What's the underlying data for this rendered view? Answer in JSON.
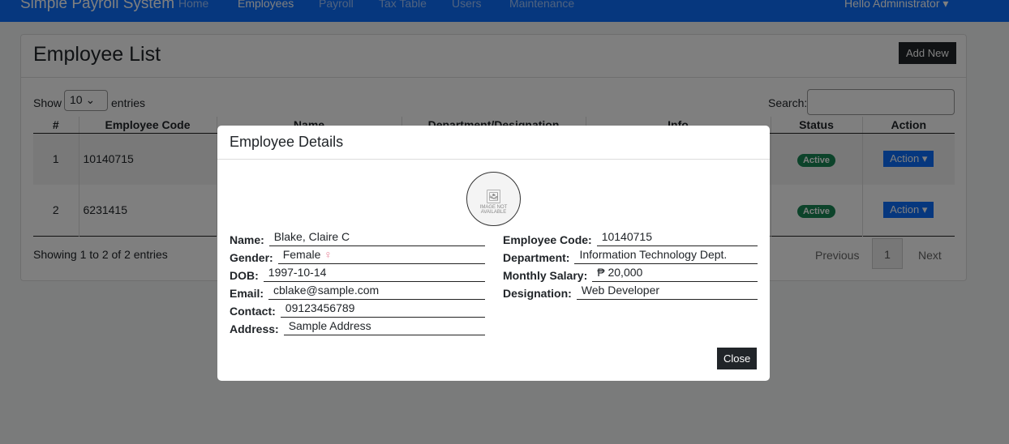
{
  "nav": {
    "brand": "Simple Payroll System",
    "items": [
      "Home",
      "Employees",
      "Payroll",
      "Tax Table",
      "Users",
      "Maintenance"
    ],
    "user": "Hello Administrator"
  },
  "card": {
    "title": "Employee List",
    "add_new": "Add New",
    "show": "Show",
    "entries_value": "10",
    "entries": "entries",
    "search": "Search:",
    "columns": [
      "#",
      "Employee Code",
      "Name",
      "Department/Designation",
      "Info",
      "Status",
      "Action"
    ],
    "rows": [
      {
        "n": "1",
        "code": "10140715",
        "status": "Active",
        "action": "Action"
      },
      {
        "n": "2",
        "code": "6231415",
        "status": "Active",
        "action": "Action"
      }
    ],
    "showing": "Showing 1 to 2 of 2 entries",
    "prev": "Previous",
    "page": "1",
    "next": "Next"
  },
  "modal": {
    "title": "Employee Details",
    "avatar_text": "IMAGE NOT AVAILABLE",
    "left": [
      {
        "label": "Name:",
        "value": "Blake, Claire C"
      },
      {
        "label": "Gender:",
        "value": "Female"
      },
      {
        "label": "DOB:",
        "value": "1997-10-14"
      },
      {
        "label": "Email:",
        "value": "cblake@sample.com"
      },
      {
        "label": "Contact:",
        "value": "09123456789"
      },
      {
        "label": "Address:",
        "value": "Sample Address"
      }
    ],
    "right": [
      {
        "label": "Employee Code:",
        "value": "10140715"
      },
      {
        "label": "Department:",
        "value": "Information Technology Dept."
      },
      {
        "label": "Monthly Salary:",
        "value": "₱ 20,000"
      },
      {
        "label": "Designation:",
        "value": "Web Developer"
      }
    ],
    "female_icon": "♀",
    "close": "Close"
  },
  "colors": {
    "primary": "#0d6efd",
    "success": "#198754",
    "female": "#e8859a"
  }
}
